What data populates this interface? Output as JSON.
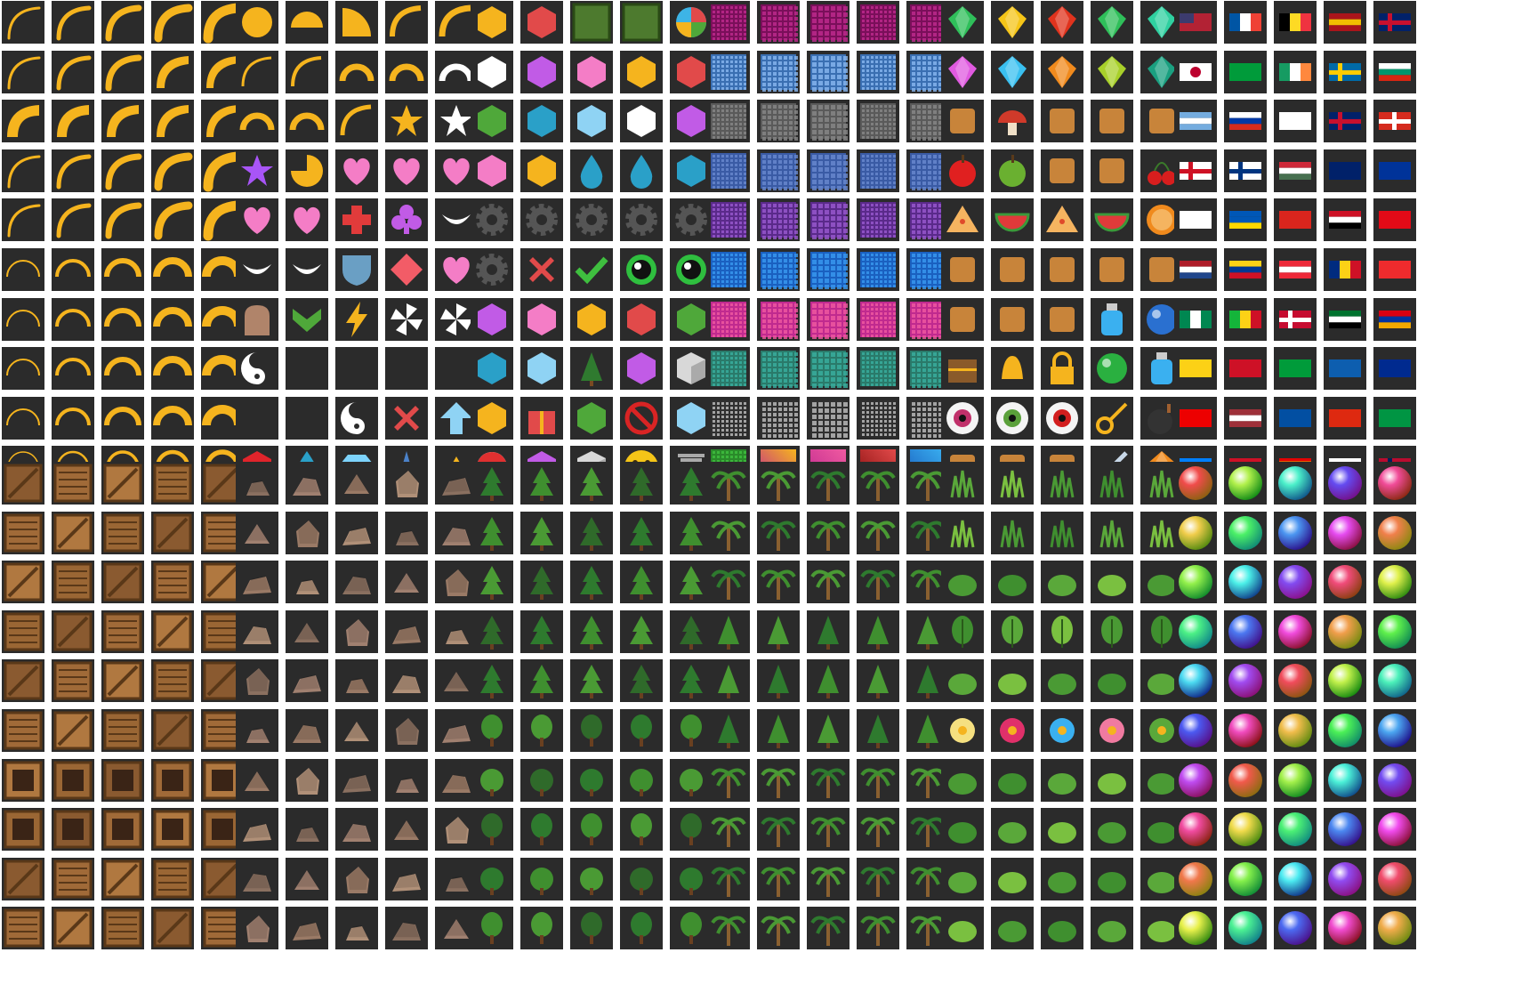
{
  "sheet": {
    "background": "#ffffff",
    "tile_background": "#2b2b2b",
    "accent": "#f5b41e",
    "groups": [
      {
        "id": "curves",
        "tile_kind": "curve",
        "rows": 10,
        "cols": 5
      },
      {
        "id": "shapes",
        "tile_kind": "shape",
        "rows": 10,
        "cols": 5,
        "icons": [
          "circle",
          "half-circle",
          "quarter-circle",
          "arc",
          "arc",
          "arc",
          "arc",
          "arch",
          "arch",
          "arch",
          "arch",
          "arch",
          "arc",
          "star",
          "star",
          "star",
          "pacman",
          "heart",
          "heart",
          "heart",
          "heart",
          "heart",
          "cross",
          "club",
          "smile",
          "smile",
          "smile",
          "shield",
          "diamond",
          "heart",
          "tombstone",
          "chevron",
          "lightning",
          "pinwheel",
          "pinwheel",
          "yin-yang",
          "crescent",
          "crescent",
          "crescent",
          "crescent",
          "crescent",
          "crescent",
          "yin-yang",
          "x-mark",
          "arrow-up",
          "hexagon",
          "drop",
          "gem",
          "four-point-star",
          "crown"
        ]
      },
      {
        "id": "objects",
        "tile_kind": "icon",
        "rows": 10,
        "cols": 5,
        "icons": [
          "star-badge",
          "yin-yang",
          "green-panel",
          "green-panel",
          "pie-chart",
          "banner",
          "pyramid",
          "monster-mouth",
          "pentagon",
          "pentagon-gem",
          "hexagon",
          "hexagon-facets",
          "octagon",
          "octagon-gem",
          "circle",
          "sphere-gem",
          "square-gem",
          "drop",
          "drop",
          "dotted-ring",
          "gear",
          "gear",
          "gear",
          "gear",
          "gear",
          "gear",
          "x-mark",
          "check-mark",
          "eye",
          "eye",
          "person",
          "rank-chevron",
          "medal",
          "cone",
          "angry-eyes",
          "monster",
          "dice-five",
          "pine-tree",
          "check-v",
          "cube",
          "stone-block",
          "gift",
          "stone-block",
          "no-sign",
          "strawberry",
          "pokeball",
          "spiked-ball",
          "cube",
          "smiley",
          "trash-can"
        ]
      },
      {
        "id": "patterns",
        "tile_kind": "pattern",
        "rows": 10,
        "cols": 5
      },
      {
        "id": "items",
        "tile_kind": "item",
        "rows": 10,
        "cols": 5,
        "icons": [
          "gem-green",
          "gem-yellow",
          "gem-red",
          "gem-green",
          "gem-teal",
          "diamond-pink",
          "diamond-blue",
          "gem-orange",
          "gem-lime",
          "gem-emerald",
          "bread",
          "mushroom",
          "wheat",
          "popsicle",
          "popsicle",
          "apple",
          "apple",
          "drumstick",
          "drumstick",
          "cherries",
          "pizza",
          "watermelon",
          "pizza",
          "watermelon",
          "orange",
          "egg",
          "sushi",
          "trophy",
          "pin",
          "chocolate",
          "screen",
          "screen",
          "screen",
          "potion",
          "orb",
          "chest",
          "bell",
          "padlock",
          "orb",
          "potion",
          "eyeball",
          "eyeball",
          "eyeball",
          "key",
          "bomb",
          "drink",
          "burger",
          "perfume",
          "sword",
          "gem-orange"
        ]
      },
      {
        "id": "flags",
        "tile_kind": "flag",
        "rows": 10,
        "cols": 5,
        "icons": [
          "us",
          "fr",
          "be",
          "es",
          "uk",
          "jp",
          "br",
          "ie",
          "se",
          "bg",
          "ar",
          "ru",
          "cl",
          "uk",
          "ch",
          "en",
          "fi",
          "hu",
          "au",
          "eu",
          "cz",
          "ua",
          "vn",
          "eg",
          "tr",
          "nl",
          "co",
          "at",
          "ro",
          "bf",
          "ng",
          "ml",
          "dk",
          "ae",
          "am",
          "gw",
          "bh",
          "jm",
          "gr",
          "cu",
          "pr",
          "lv",
          "kp",
          "cn",
          "cg",
          "cd",
          "tt",
          "rainbow",
          "il",
          "no"
        ]
      },
      {
        "id": "crates",
        "tile_kind": "crate",
        "rows": 10,
        "cols": 5
      },
      {
        "id": "rocks",
        "tile_kind": "rock",
        "rows": 10,
        "cols": 5
      },
      {
        "id": "trees",
        "tile_kind": "tree",
        "rows": 10,
        "cols": 5
      },
      {
        "id": "palms",
        "tile_kind": "palm",
        "rows": 10,
        "cols": 5
      },
      {
        "id": "plants",
        "tile_kind": "plant",
        "rows": 10,
        "cols": 5
      },
      {
        "id": "orbs",
        "tile_kind": "orb",
        "rows": 10,
        "cols": 5
      }
    ]
  }
}
